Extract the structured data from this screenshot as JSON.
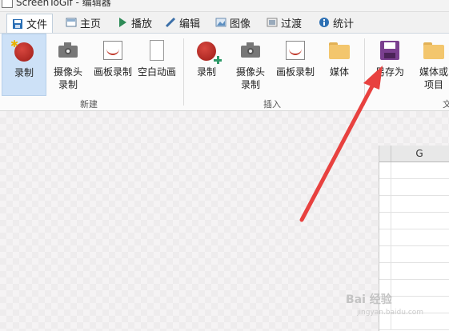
{
  "window": {
    "title": "ScreenToGif - 编辑器"
  },
  "tabs": [
    {
      "label": "文件",
      "icon": "save-icon",
      "active": true
    },
    {
      "label": "主页",
      "icon": "home-icon"
    },
    {
      "label": "播放",
      "icon": "play-icon"
    },
    {
      "label": "编辑",
      "icon": "pencil-icon"
    },
    {
      "label": "图像",
      "icon": "image-icon"
    },
    {
      "label": "过渡",
      "icon": "transition-icon"
    },
    {
      "label": "统计",
      "icon": "info-icon"
    }
  ],
  "ribbon": {
    "groups": [
      {
        "label": "新建",
        "items": [
          "录制",
          "摄像头\n录制",
          "画板录制",
          "空白动画"
        ]
      },
      {
        "label": "插入",
        "items": [
          "录制",
          "摄像头\n录制",
          "画板录制",
          "媒体"
        ]
      },
      {
        "label": "",
        "items": [
          "另存为",
          "媒体或\n项目"
        ]
      }
    ],
    "partial_label": "文"
  },
  "spreadsheet": {
    "column": "G"
  },
  "watermark": {
    "text": "Bai 经验",
    "sub": "jingyan.baidu.com"
  },
  "colors": {
    "accent": "#cde1f7",
    "arrow": "#e8413f",
    "record": "#b0241f",
    "save": "#7a3f8f"
  }
}
